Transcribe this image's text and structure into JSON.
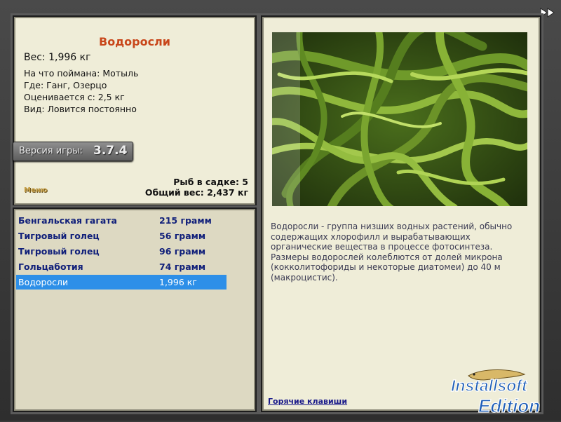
{
  "info": {
    "title": "Водоросли",
    "weight": "Вес: 1,996 кг",
    "caught_on": "На что поймана: Мотыль",
    "where": "Где: Ганг, Озерцо",
    "rated_from": "Оценивается с: 2,5 кг",
    "kind": "Вид: Ловится постоянно",
    "version_label": "Версия игры:",
    "version_number": "3.7.4",
    "menu_link": "Меню",
    "cage_count": "Рыб в садке: 5",
    "total_weight": "Общий вес: 2,437 кг"
  },
  "catch_list": [
    {
      "name": "Бенгальская гагата",
      "weight": "215 грамм",
      "selected": false
    },
    {
      "name": "Тигровый голец",
      "weight": "56 грамм",
      "selected": false
    },
    {
      "name": "Тигровый голец",
      "weight": "96 грамм",
      "selected": false
    },
    {
      "name": "Гольцаботия",
      "weight": "74 грамм",
      "selected": false
    },
    {
      "name": "Водоросли",
      "weight": "1,996 кг",
      "selected": true
    }
  ],
  "detail": {
    "image": "seaweed-photo",
    "description": "Водоросли - группа низших водных растений, обычно содержащих хлорофилл и вырабатывающих органические вещества в процессе фотосинтеза. Размеры водорослей колеблются от долей микрона (кокколитофориды и некоторые диатомеи) до 40 м (макроцистис).",
    "hotkeys_link": "Горячие клавиши"
  },
  "logo": {
    "line1": "Installsoft",
    "line2": "Edition"
  },
  "colors": {
    "title": "#c8461a",
    "list_text": "#11207a",
    "selection": "#2d8fe8",
    "panel": "#efedd8"
  }
}
